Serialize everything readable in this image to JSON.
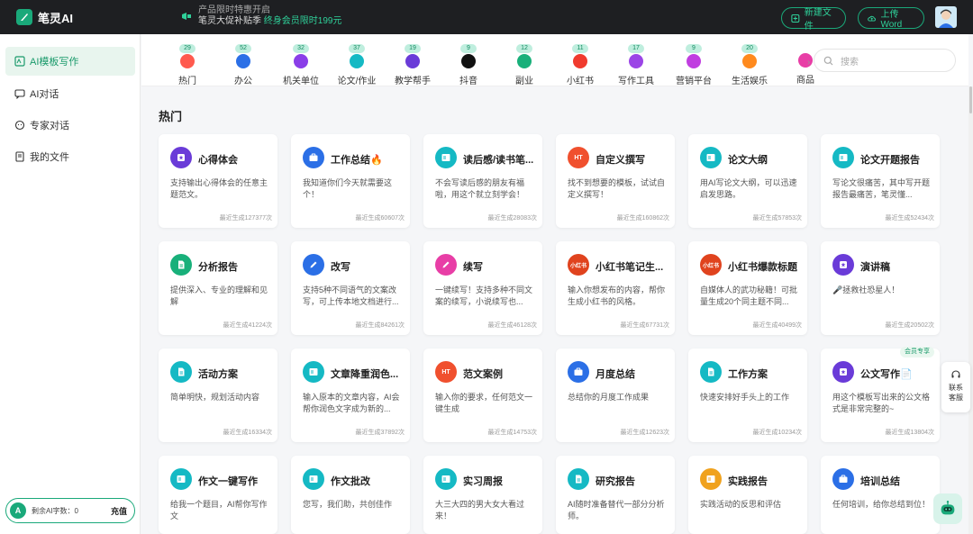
{
  "app": {
    "name": "笔灵AI"
  },
  "promo": {
    "line1": "产品限时特惠开启",
    "line2_prefix": "笔灵大促补贴季",
    "line2_highlight": "终身会员限时199元"
  },
  "topbar": {
    "new_file": "新建文件",
    "upload_word": "上传Word"
  },
  "sidebar": {
    "items": [
      {
        "label": "AI模板写作"
      },
      {
        "label": "AI对话"
      },
      {
        "label": "专家对话"
      },
      {
        "label": "我的文件"
      }
    ],
    "quota": {
      "badge": "A",
      "label": "剩余AI字数：0",
      "recharge": "充值"
    }
  },
  "categories": [
    {
      "label": "热门",
      "count": "29",
      "color": "#ff5a4e"
    },
    {
      "label": "办公",
      "count": "52",
      "color": "#2b6fe6"
    },
    {
      "label": "机关单位",
      "count": "32",
      "color": "#8a3ee8"
    },
    {
      "label": "论文/作业",
      "count": "37",
      "color": "#15b9c4"
    },
    {
      "label": "教学帮手",
      "count": "19",
      "color": "#6a3bd8"
    },
    {
      "label": "抖音",
      "count": "9",
      "color": "#111111"
    },
    {
      "label": "副业",
      "count": "12",
      "color": "#18b07a"
    },
    {
      "label": "小红书",
      "count": "11",
      "color": "#f03b2e"
    },
    {
      "label": "写作工具",
      "count": "17",
      "color": "#9b45e6"
    },
    {
      "label": "营销平台",
      "count": "9",
      "color": "#c03ee0"
    },
    {
      "label": "生活娱乐",
      "count": "20",
      "color": "#ff8a1e"
    },
    {
      "label": "商品",
      "count": "",
      "color": "#e83ea6"
    }
  ],
  "search": {
    "placeholder": "搜索"
  },
  "section": {
    "title": "热门"
  },
  "cards": [
    {
      "title": "心得体会",
      "desc": "支持输出心得体会的任意主题范文。",
      "foot": "最近生成127377次",
      "color": "#6a3bd8",
      "icon": "star-icon"
    },
    {
      "title": "工作总结🔥",
      "desc": "我知道你们今天就需要这个！",
      "foot": "最近生成60607次",
      "color": "#2b6fe6",
      "icon": "briefcase-icon"
    },
    {
      "title": "读后感/读书笔...",
      "desc": "不会写读后感的朋友有福啦，用这个就立刻学会！",
      "foot": "最近生成28083次",
      "color": "#15b9c4",
      "icon": "book-icon"
    },
    {
      "title": "自定义撰写",
      "desc": "找不到想要的模板，试试自定义撰写！",
      "foot": "最近生成160862次",
      "color": "#f0502e",
      "icon": "ht-icon"
    },
    {
      "title": "论文大纲",
      "desc": "用AI写论文大纲，可以迅速启发思路。",
      "foot": "最近生成57853次",
      "color": "#15b9c4",
      "icon": "book-icon"
    },
    {
      "title": "论文开题报告",
      "desc": "写论文很痛苦，其中写开题报告最痛苦，笔灵懂...",
      "foot": "最近生成52434次",
      "color": "#15b9c4",
      "icon": "book-icon"
    },
    {
      "title": "分析报告",
      "desc": "提供深入、专业的理解和见解",
      "foot": "最近生成41224次",
      "color": "#18b07a",
      "icon": "doc-icon"
    },
    {
      "title": "改写",
      "desc": "支持5种不同语气的文案改写，可上传本地文档进行...",
      "foot": "最近生成84261次",
      "color": "#2b6fe6",
      "icon": "pen-icon"
    },
    {
      "title": "续写",
      "desc": "一键续写！支持多种不同文案的续写，小说续写也...",
      "foot": "最近生成46128次",
      "color": "#e83ea6",
      "icon": "pen-icon"
    },
    {
      "title": "小红书笔记生...",
      "desc": "输入你想发布的内容，帮你生成小红书的风格。",
      "foot": "最近生成67731次",
      "color": "#e0431e",
      "icon": "xhs-icon"
    },
    {
      "title": "小红书爆款标题",
      "desc": "自媒体人的武功秘籍！可批量生成20个同主题不同...",
      "foot": "最近生成40499次",
      "color": "#e0431e",
      "icon": "xhs-icon"
    },
    {
      "title": "演讲稿",
      "desc": "🎤拯救社恐星人！",
      "foot": "最近生成20502次",
      "color": "#6a3bd8",
      "icon": "star-icon"
    },
    {
      "title": "活动方案",
      "desc": "简单明快，规划活动内容",
      "foot": "最近生成16334次",
      "color": "#15b9c4",
      "icon": "doc-icon"
    },
    {
      "title": "文章降重润色...",
      "desc": "输入原本的文章内容，AI会帮你润色文字成为新的...",
      "foot": "最近生成37892次",
      "color": "#15b9c4",
      "icon": "book-icon"
    },
    {
      "title": "范文案例",
      "desc": "输入你的要求，任何范文一键生成",
      "foot": "最近生成14753次",
      "color": "#f0502e",
      "icon": "ht-icon"
    },
    {
      "title": "月度总结",
      "desc": "总结你的月度工作成果",
      "foot": "最近生成12623次",
      "color": "#2b6fe6",
      "icon": "briefcase-icon"
    },
    {
      "title": "工作方案",
      "desc": "快速安排好手头上的工作",
      "foot": "最近生成10234次",
      "color": "#15b9c4",
      "icon": "doc-icon"
    },
    {
      "title": "公文写作📄",
      "desc": "用这个模板写出来的公文格式是非常完整的~",
      "foot": "最近生成13804次",
      "color": "#6a3bd8",
      "icon": "star-icon",
      "vip": "会员专享"
    },
    {
      "title": "作文一键写作",
      "desc": "给我一个题目，AI帮你写作文",
      "foot": "",
      "color": "#15b9c4",
      "icon": "book-icon"
    },
    {
      "title": "作文批改",
      "desc": "您写，我们助，共创佳作",
      "foot": "",
      "color": "#15b9c4",
      "icon": "book-icon"
    },
    {
      "title": "实习周报",
      "desc": "大三大四的男大女大看过来！",
      "foot": "",
      "color": "#15b9c4",
      "icon": "book-icon"
    },
    {
      "title": "研究报告",
      "desc": "AI随时准备替代一部分分析师。",
      "foot": "",
      "color": "#15b9c4",
      "icon": "doc-icon"
    },
    {
      "title": "实践报告",
      "desc": "实践活动的反思和评估",
      "foot": "",
      "color": "#f0a21e",
      "icon": "book-icon"
    },
    {
      "title": "培训总结",
      "desc": "任何培训，给你总结到位！",
      "foot": "",
      "color": "#2b6fe6",
      "icon": "briefcase-icon"
    }
  ],
  "float": {
    "help_line1": "联系",
    "help_line2": "客服"
  },
  "colors": {
    "brand": "#1aa97a",
    "topbar": "#1e1f22"
  }
}
